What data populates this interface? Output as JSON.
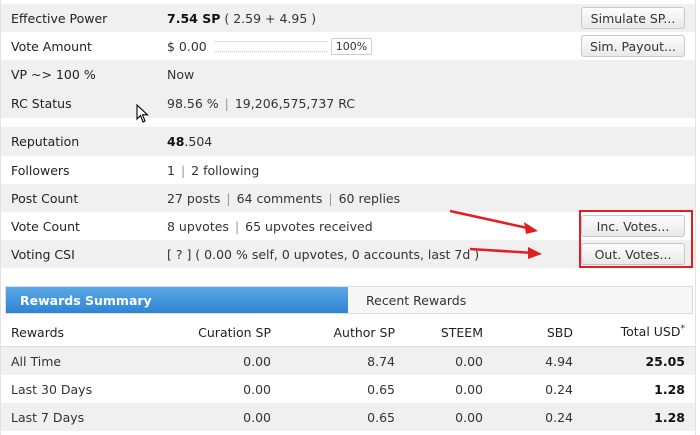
{
  "rows": [
    {
      "label": "Effective Power",
      "bold": "7.54 SP",
      "rest": "( 2.59 + 4.95 )",
      "button": "Simulate SP..."
    },
    {
      "label": "Vote Amount",
      "value": "$ 0.00",
      "pct": "100%",
      "button": "Sim. Payout..."
    },
    {
      "label": "VP ~> 100 %",
      "value": "Now"
    },
    {
      "label": "RC Status",
      "value_a": "98.56 %",
      "value_b": "19,206,575,737 RC"
    },
    {
      "label": "Reputation",
      "bold": "48",
      "rest": ".504"
    },
    {
      "label": "Followers",
      "value_a": "1",
      "value_b": "2 following"
    },
    {
      "label": "Post Count",
      "value_a": "27 posts",
      "value_b": "64 comments",
      "value_c": "60 replies"
    },
    {
      "label": "Vote Count",
      "value_a": "8 upvotes",
      "value_b": "65 upvotes received",
      "button": "Inc. Votes..."
    },
    {
      "label": "Voting CSI",
      "value": "[ ? ] ( 0.00 % self, 0 upvotes, 0 accounts, last 7d )",
      "button": "Out. Votes..."
    }
  ],
  "tabs": {
    "active": "Rewards Summary",
    "other": "Recent Rewards"
  },
  "rewards": {
    "headers": [
      "Rewards",
      "Curation SP",
      "Author SP",
      "STEEM",
      "SBD",
      "Total USD"
    ],
    "header_mark": "*",
    "rows": [
      [
        "All Time",
        "0.00",
        "8.74",
        "0.00",
        "4.94",
        "25.05"
      ],
      [
        "Last 30 Days",
        "0.00",
        "0.65",
        "0.00",
        "0.24",
        "1.28"
      ],
      [
        "Last 7 Days",
        "0.00",
        "0.65",
        "0.00",
        "0.24",
        "1.28"
      ]
    ]
  },
  "colors": {
    "tab_active": "#3a8fd8",
    "highlight": "#e02020",
    "row_alt": "#f0f0f0"
  }
}
